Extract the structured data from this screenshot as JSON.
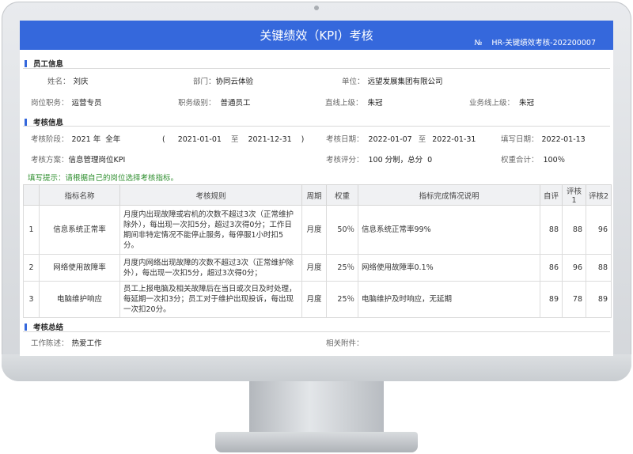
{
  "header": {
    "title": "关键绩效（KPI）考核",
    "no_symbol": "№",
    "doc_no": "HR-关键绩效考核-202200007"
  },
  "employee": {
    "section_title": "员工信息",
    "name_label": "姓名：",
    "name": "刘庆",
    "dept_label": "部门：",
    "dept": "协同云体验",
    "unit_label": "单位：",
    "unit": "远望发展集团有限公司",
    "position_label": "岗位职务：",
    "position": "运营专员",
    "level_label": "职务级别：",
    "level": "普通员工",
    "direct_sup_label": "直线上级：",
    "direct_sup": "朱冠",
    "biz_sup_label": "业务线上级：",
    "biz_sup": "朱冠"
  },
  "assessment": {
    "section_title": "考核信息",
    "stage_label": "考核阶段：",
    "stage_year": "2021 年",
    "stage_period": "全年",
    "paren_open": "(",
    "period_start": "2021-01-01",
    "to_1": "至",
    "period_end": "2021-12-31",
    "paren_close": ")",
    "date_label": "考核日期：",
    "date_start": "2022-01-07",
    "to_2": "至",
    "date_end": "2022-01-31",
    "fill_label": "填写日期：",
    "fill_date": "2022-01-13",
    "plan_label": "考核方案：",
    "plan": "信息管理岗位KPI",
    "score_label": "考核评分：",
    "score_text": "100 分制，总分",
    "total": "0",
    "weight_label": "权重合计：",
    "weight_total": "100％"
  },
  "hint": "填写提示：请根据自己的岗位选择考核指标。",
  "table": {
    "headers": [
      "",
      "指标名称",
      "考核规则",
      "周期",
      "权重",
      "指标完成情况说明",
      "自评",
      "评核1",
      "评核2"
    ],
    "rows": [
      {
        "no": "1",
        "name": "信息系统正常率",
        "rule": "月度内出现故障或宕机的次数不超过3次（正常维护除外），每出现一次扣5分，超过3次得0分；工作日期间非特定情况不能停止服务，每停服1小时扣5分。",
        "cycle": "月度",
        "weight": "50％",
        "desc": "信息系统正常率99%",
        "self": "88",
        "r1": "88",
        "r2": "96"
      },
      {
        "no": "2",
        "name": "网络使用故障率",
        "rule": "月度内网络出现故障的次数不超过3次（正常维护除外），每出现一次扣5分，超过3次得0分；",
        "cycle": "月度",
        "weight": "25％",
        "desc": "网络使用故障率0.1%",
        "self": "86",
        "r1": "96",
        "r2": "88"
      },
      {
        "no": "3",
        "name": "电脑维护响应",
        "rule": "员工上报电脑及相关故障后在当日或次日及时处理，每延期一次扣3分；员工对于维护出现投诉，每出现一次扣20分。",
        "cycle": "月度",
        "weight": "25％",
        "desc": "电脑维护及时响应，无延期",
        "self": "89",
        "r1": "78",
        "r2": "89"
      }
    ]
  },
  "summary": {
    "section_title": "考核总结",
    "work_label": "工作陈述：",
    "work": "热爱工作",
    "attach_label": "相关附件："
  },
  "colors": {
    "accent": "#3568dc",
    "hint": "#2f8f2f"
  }
}
